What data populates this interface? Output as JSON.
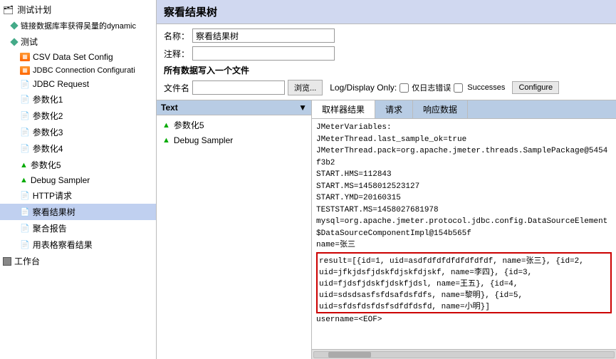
{
  "sidebar": {
    "items": [
      {
        "id": "test-plan",
        "label": "测试计划",
        "indent": 0,
        "icon": "test-plan-icon",
        "selected": false
      },
      {
        "id": "link-data",
        "label": "链接数据库率获得吴量的dynamic",
        "indent": 1,
        "icon": "thread-icon",
        "selected": false
      },
      {
        "id": "ce-shi",
        "label": "测试",
        "indent": 1,
        "icon": "thread-icon",
        "selected": false
      },
      {
        "id": "csv",
        "label": "CSV Data Set Config",
        "indent": 2,
        "icon": "csv-icon",
        "selected": false
      },
      {
        "id": "jdbc-config",
        "label": "JDBC Connection Configurati",
        "indent": 2,
        "icon": "jdbc-icon",
        "selected": false
      },
      {
        "id": "jdbc-request",
        "label": "JDBC Request",
        "indent": 2,
        "icon": "sampler-icon",
        "selected": false
      },
      {
        "id": "canshuhua1",
        "label": "参数化1",
        "indent": 2,
        "icon": "page-icon",
        "selected": false
      },
      {
        "id": "canshuhua2",
        "label": "参数化2",
        "indent": 2,
        "icon": "page-icon",
        "selected": false
      },
      {
        "id": "canshuhua3",
        "label": "参数化3",
        "indent": 2,
        "icon": "page-icon",
        "selected": false
      },
      {
        "id": "canshuhua4",
        "label": "参数化4",
        "indent": 2,
        "icon": "page-icon",
        "selected": false
      },
      {
        "id": "canshuhua5",
        "label": "参数化5",
        "indent": 2,
        "icon": "leaf-icon",
        "selected": false
      },
      {
        "id": "debug-sampler",
        "label": "Debug Sampler",
        "indent": 2,
        "icon": "leaf-icon",
        "selected": false
      },
      {
        "id": "http-request",
        "label": "HTTP请求",
        "indent": 2,
        "icon": "page-icon",
        "selected": false
      },
      {
        "id": "view-results",
        "label": "察看结果树",
        "indent": 2,
        "icon": "page-icon",
        "selected": true
      },
      {
        "id": "aggregate",
        "label": "聚合报告",
        "indent": 2,
        "icon": "page-icon",
        "selected": false
      },
      {
        "id": "table-results",
        "label": "用表格察看结果",
        "indent": 2,
        "icon": "page-icon",
        "selected": false
      },
      {
        "id": "workbench",
        "label": "工作台",
        "indent": 0,
        "icon": "workbench-icon",
        "selected": false
      }
    ]
  },
  "panel": {
    "title": "察看结果树",
    "name_label": "名称：",
    "name_value": "察看结果树",
    "comment_label": "注释：",
    "comment_value": "",
    "write_label": "所有数据写入一个文件",
    "filename_label": "文件名",
    "filename_value": "",
    "browse_label": "浏览...",
    "log_display_label": "Log/Display Only:",
    "errors_label": "仅日志错误",
    "successes_label": "Successes",
    "configure_label": "Configure"
  },
  "text_panel": {
    "header": "Text",
    "items": [
      {
        "label": "参数化5",
        "icon": "green-triangle"
      },
      {
        "label": "Debug Sampler",
        "icon": "green-triangle"
      }
    ]
  },
  "tabs": [
    {
      "id": "sampler-result",
      "label": "取样器结果",
      "active": true
    },
    {
      "id": "request",
      "label": "请求",
      "active": false
    },
    {
      "id": "response-data",
      "label": "响应数据",
      "active": false
    }
  ],
  "results": {
    "lines": [
      "JMeterVariables:",
      "JMeterThread.last_sample_ok=true",
      "JMeterThread.pack=org.apache.jmeter.threads.SamplePackage@5454f3b2",
      "START.HMS=112843",
      "START.MS=1458012523127",
      "START.YMD=20160315",
      "TESTSTART.MS=1458027681978",
      "mysql=org.apache.jmeter.protocol.jdbc.config.DataSourceElement$DataSourceComponentImpl@154b565f",
      "name=张三"
    ],
    "highlighted": "result=[{id=1, uid=asdfdfdfdfdfdfdfdf, name=张三}, {id=2, uid=jfkjdsfjdskfdjskfdjskf, name=李四}, {id=3, uid=fjdsfjdskfjdskfjdsl, name=王五}, {id=4, uid=sdsdsasfsfdsafdsfdfs, name=黎明}, {id=5, uid=sfdsfdsfdsfsdfdfdsfd, name=小明}]",
    "last_line": "username=<EOF>"
  }
}
